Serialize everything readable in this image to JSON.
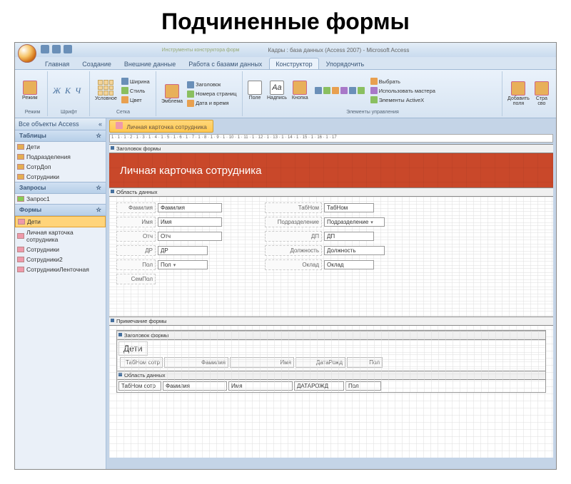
{
  "slide_title": "Подчиненные формы",
  "app_title_context": "Инструменты конструктора форм",
  "app_title_file": "Кадры : база данных (Access 2007) - Microsoft Access",
  "tabs": [
    "Главная",
    "Создание",
    "Внешние данные",
    "Работа с базами данных",
    "Конструктор",
    "Упорядочить"
  ],
  "active_tab": 4,
  "ribbon": {
    "views": {
      "label": "Режим",
      "btn": "Режим"
    },
    "font": {
      "label": "Шрифт",
      "letters": [
        "Ж",
        "К",
        "Ч"
      ]
    },
    "gridlines": {
      "label": "Сетка",
      "items": [
        "Ширина",
        "Стиль",
        "Цвет"
      ],
      "big": "Условное"
    },
    "header": {
      "label": "",
      "items": [
        "Заголовок",
        "Номера страниц",
        "Дата и время"
      ],
      "big": "Эмблема"
    },
    "controls": {
      "label": "Элементы управления",
      "items": [
        "Поле",
        "Надпись",
        "Кнопка"
      ],
      "more": [
        "Выбрать",
        "Использовать мастера",
        "Элементы ActiveX"
      ]
    },
    "tools": {
      "label": "",
      "add_fields": "Добавить\nполя",
      "prop": "Стра\nсво"
    }
  },
  "nav": {
    "title": "Все объекты Access",
    "cats": [
      {
        "name": "Таблицы",
        "items": [
          "Дети",
          "Подразделения",
          "СотрДоп",
          "Сотрудники"
        ],
        "icon": "t"
      },
      {
        "name": "Запросы",
        "items": [
          "Запрос1"
        ],
        "icon": "q"
      },
      {
        "name": "Формы",
        "items": [
          "Дети",
          "Личная карточка сотрудника",
          "Сотрудники",
          "Сотрудники2",
          "СотрудникиЛенточная"
        ],
        "icon": "f",
        "active": 0
      }
    ]
  },
  "doc_tab": "Личная карточка сотрудника",
  "ruler": "1 · 1 · 1 · 2 · 1 · 3 · 1 · 4 · 1 · 5 · 1 · 6 · 1 · 7 · 1 · 8 · 1 · 9 · 1 · 10 · 1 · 11 · 1 · 12 · 1 · 13 · 1 · 14 · 1 · 15 · 1 · 16 · 1 · 17",
  "sections": {
    "form_header": "Заголовок формы",
    "detail": "Область данных",
    "form_footer": "Примечание формы"
  },
  "form_title": "Личная карточка сотрудника",
  "fields_left": [
    {
      "label": "Фамилия",
      "value": "Фамилия",
      "lw": 55,
      "vw": 90
    },
    {
      "label": "Имя",
      "value": "Имя",
      "lw": 55,
      "vw": 90
    },
    {
      "label": "Отч",
      "value": "Отч",
      "lw": 55,
      "vw": 90
    },
    {
      "label": "ДР",
      "value": "ДР",
      "lw": 55,
      "vw": 70
    },
    {
      "label": "Пол",
      "value": "Пол",
      "lw": 55,
      "vw": 70,
      "combo": true
    },
    {
      "label": "СемПол",
      "value": "",
      "lw": 55,
      "vw": 0
    }
  ],
  "fields_right": [
    {
      "label": "ТабНом",
      "value": "ТабНом",
      "lw": 80,
      "vw": 70
    },
    {
      "label": "Подразделение",
      "value": "Подразделение",
      "lw": 80,
      "vw": 85,
      "combo": true
    },
    {
      "label": "ДП",
      "value": "ДП",
      "lw": 80,
      "vw": 70
    },
    {
      "label": "Должность",
      "value": "Должность",
      "lw": 80,
      "vw": 85
    },
    {
      "label": "Оклад",
      "value": "Оклад",
      "lw": 80,
      "vw": 70
    }
  ],
  "subform": {
    "title": "Дети",
    "header_labels": [
      {
        "text": "ТабНом сотр",
        "w": 60
      },
      {
        "text": "Фамилия",
        "w": 90
      },
      {
        "text": "Имя",
        "w": 90
      },
      {
        "text": "ДатаРожд",
        "w": 70
      },
      {
        "text": "Пол",
        "w": 50
      }
    ],
    "detail_fields": [
      {
        "text": "ТабНом сотр",
        "w": 60
      },
      {
        "text": "Фамилия",
        "w": 90
      },
      {
        "text": "Имя",
        "w": 90
      },
      {
        "text": "ДАТАРОЖД",
        "w": 70
      },
      {
        "text": "Пол",
        "w": 50
      }
    ]
  }
}
